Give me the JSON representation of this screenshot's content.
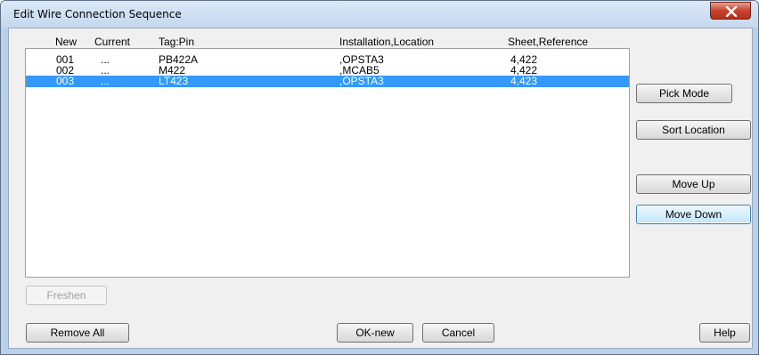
{
  "window": {
    "title": "Edit Wire Connection Sequence"
  },
  "columns": {
    "new": "New",
    "current": "Current",
    "tag_pin": "Tag:Pin",
    "installation_location": "Installation,Location",
    "sheet_reference": "Sheet,Reference"
  },
  "rows": [
    {
      "new": "001",
      "current": "...",
      "tag_pin": "PB422A",
      "installation_location": ",OPSTA3",
      "sheet_reference": "4,422",
      "selected": false
    },
    {
      "new": "002",
      "current": "...",
      "tag_pin": "M422",
      "installation_location": ",MCAB5",
      "sheet_reference": "4,422",
      "selected": false
    },
    {
      "new": "003",
      "current": "...",
      "tag_pin": "LT423",
      "installation_location": ",OPSTA3",
      "sheet_reference": "4,423",
      "selected": true
    }
  ],
  "buttons": {
    "pick_mode": "Pick Mode",
    "sort_location": "Sort Location",
    "move_up": "Move Up",
    "move_down": "Move Down",
    "freshen": "Freshen",
    "remove_all": "Remove All",
    "ok_new": "OK-new",
    "cancel": "Cancel",
    "help": "Help"
  },
  "icons": {
    "close": "close-icon"
  },
  "colors": {
    "selection": "#3399ff",
    "close_button": "#c7432d",
    "focus_border": "#3c7fb1"
  }
}
